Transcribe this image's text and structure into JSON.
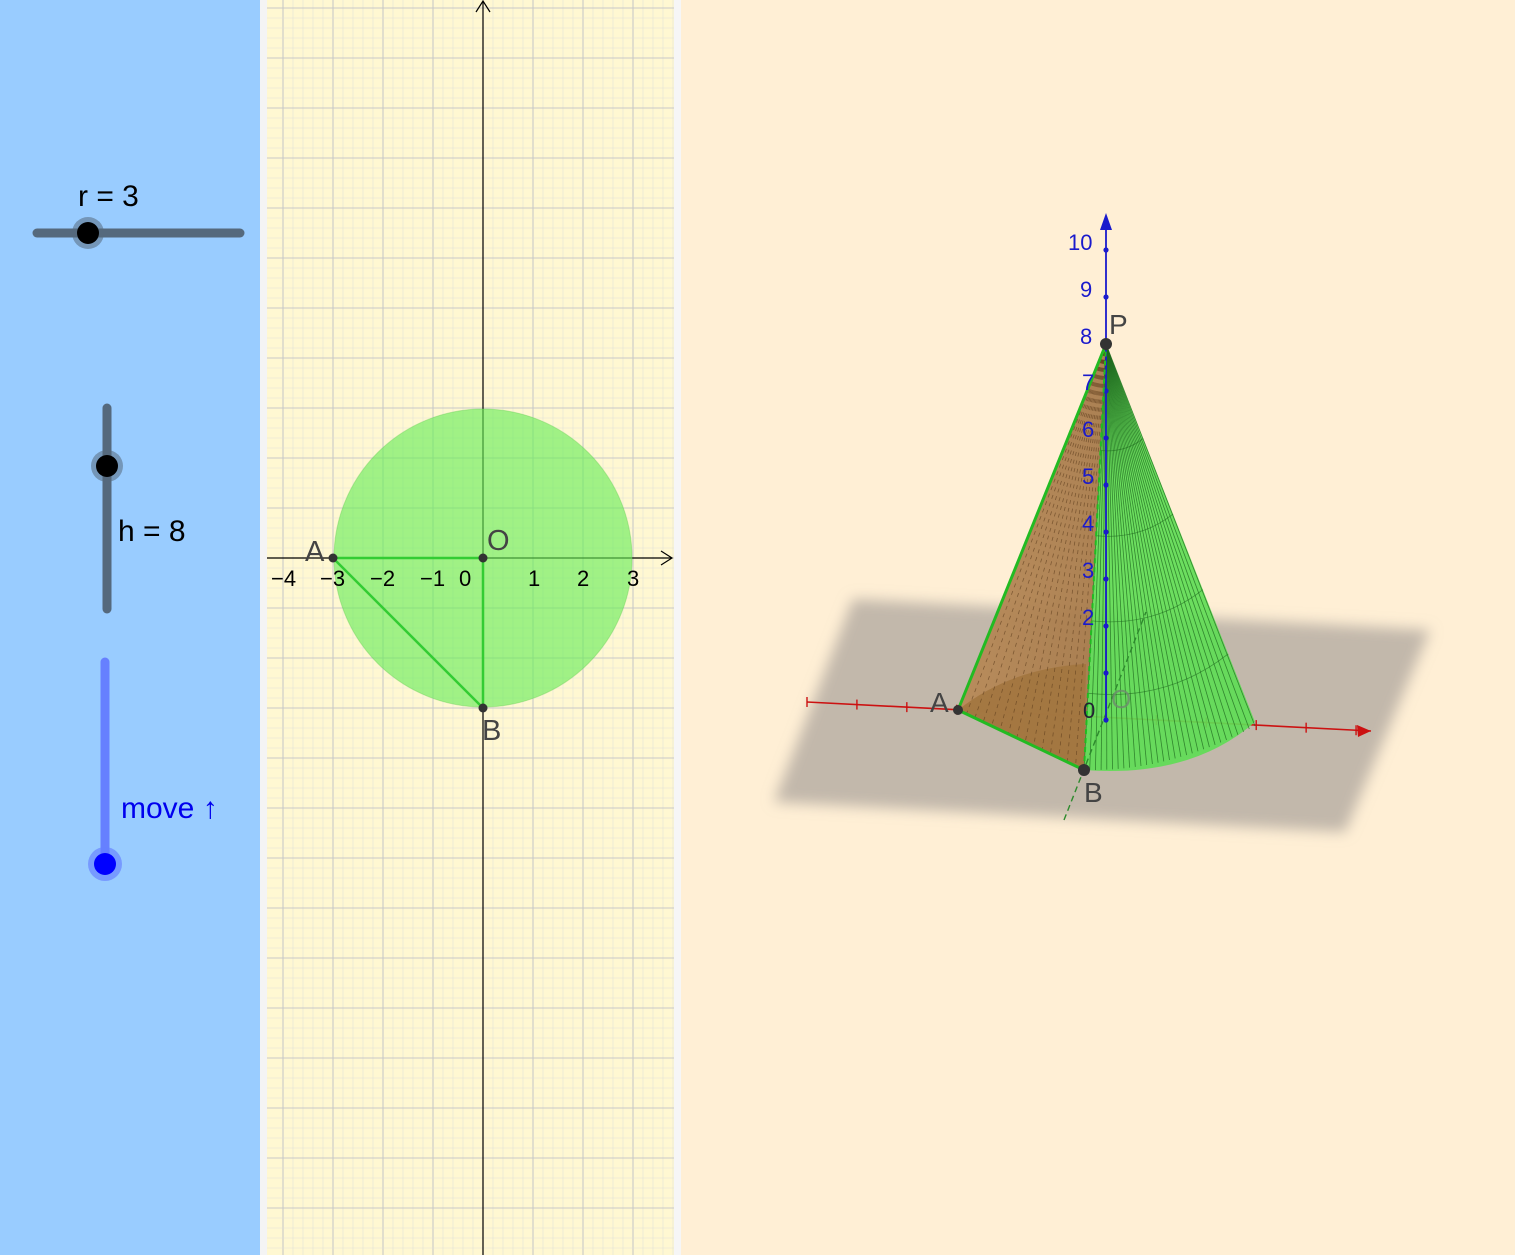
{
  "colors": {
    "sidebar_bg": "#99ccff",
    "graphics_bg": "#fff8d2",
    "view3d_bg": "#ffefd5",
    "cone_green": "#33cc33",
    "slider_track": "#55697d",
    "move_slider": "#6680ff",
    "move_knob": "#0000ff"
  },
  "sliders": {
    "r": {
      "label": "r = 3",
      "value": 3
    },
    "h": {
      "label": "h = 8",
      "value": 8
    },
    "move": {
      "label": "move ↑"
    }
  },
  "graphics2d": {
    "points": {
      "A": "A",
      "O": "O",
      "B": "B"
    },
    "x_ticks": [
      "−4",
      "−3",
      "−2",
      "−1",
      "0",
      "1",
      "2",
      "3"
    ],
    "circle_radius": 3
  },
  "graphics3d": {
    "z_ticks": [
      "2",
      "3",
      "4",
      "5",
      "6",
      "7",
      "8",
      "9",
      "10"
    ],
    "points": {
      "A": "A",
      "B": "B",
      "O": "O",
      "P": "P"
    },
    "origin_label": "0"
  }
}
